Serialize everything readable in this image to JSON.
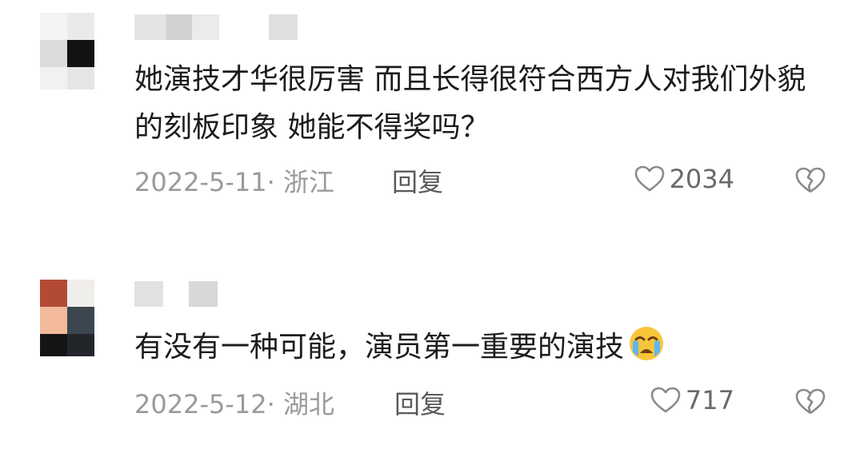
{
  "comments": [
    {
      "text": "她演技才华很厉害 而且长得很符合西方人对我们外貌的刻板印象 她能不得奖吗？",
      "date": "2022-5-11",
      "location": "浙江",
      "reply_label": "回复",
      "likes": "2034"
    },
    {
      "text": "有没有一种可能，演员第一重要的演技",
      "emoji": "crying-face-emoji",
      "date": "2022-5-12",
      "location": "湖北",
      "reply_label": "回复",
      "likes": "717"
    }
  ],
  "colors": {
    "text": "#1c1c1c",
    "meta": "#9a9a9a",
    "reply": "#5a5a5a",
    "icon": "#8a8a8a"
  }
}
